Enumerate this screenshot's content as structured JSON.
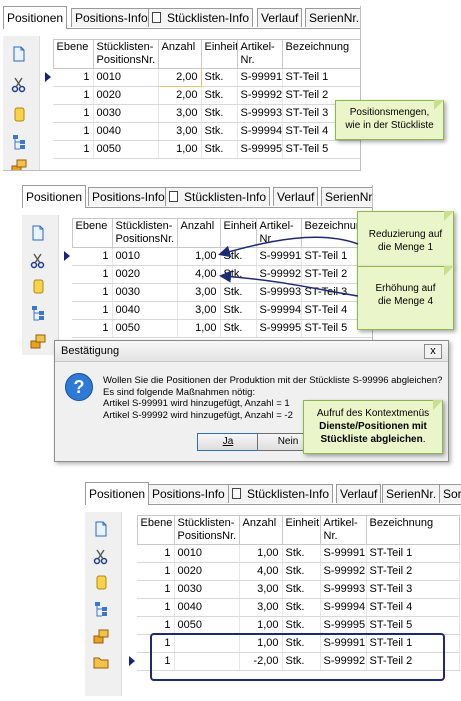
{
  "tabs": [
    "Positionen",
    "Positions-Info",
    "Stücklisten-Info",
    "Verlauf",
    "SerienNr.",
    "Sor"
  ],
  "columns": {
    "ebene": "Ebene",
    "pos": "Stücklisten-\nPositionsNr.",
    "anzahl": "Anzahl",
    "einheit": "Einheit",
    "artikel": "Artikel-\nNr.",
    "bezeichnung": "Bezeichnung"
  },
  "grid1": [
    {
      "ebene": "1",
      "pos": "0010",
      "anzahl": "2,00",
      "einheit": "Stk.",
      "artikel": "S-99991",
      "bez": "ST-Teil 1"
    },
    {
      "ebene": "1",
      "pos": "0020",
      "anzahl": "2,00",
      "einheit": "Stk.",
      "artikel": "S-99992",
      "bez": "ST-Teil 2"
    },
    {
      "ebene": "1",
      "pos": "0030",
      "anzahl": "3,00",
      "einheit": "Stk.",
      "artikel": "S-99993",
      "bez": "ST-Teil 3"
    },
    {
      "ebene": "1",
      "pos": "0040",
      "anzahl": "3,00",
      "einheit": "Stk.",
      "artikel": "S-99994",
      "bez": "ST-Teil 4"
    },
    {
      "ebene": "1",
      "pos": "0050",
      "anzahl": "1,00",
      "einheit": "Stk.",
      "artikel": "S-99995",
      "bez": "ST-Teil 5"
    }
  ],
  "grid2": [
    {
      "ebene": "1",
      "pos": "0010",
      "anzahl": "1,00",
      "einheit": "Stk.",
      "artikel": "S-99991",
      "bez": "ST-Teil 1"
    },
    {
      "ebene": "1",
      "pos": "0020",
      "anzahl": "4,00",
      "einheit": "Stk.",
      "artikel": "S-99992",
      "bez": "ST-Teil 2"
    },
    {
      "ebene": "1",
      "pos": "0030",
      "anzahl": "3,00",
      "einheit": "Stk.",
      "artikel": "S-99993",
      "bez": "ST-Teil 3"
    },
    {
      "ebene": "1",
      "pos": "0040",
      "anzahl": "3,00",
      "einheit": "Stk.",
      "artikel": "S-99994",
      "bez": "ST-Teil 4"
    },
    {
      "ebene": "1",
      "pos": "0050",
      "anzahl": "1,00",
      "einheit": "Stk.",
      "artikel": "S-99995",
      "bez": "ST-Teil 5"
    }
  ],
  "grid3": [
    {
      "ebene": "1",
      "pos": "0010",
      "anzahl": "1,00",
      "einheit": "Stk.",
      "artikel": "S-99991",
      "bez": "ST-Teil 1"
    },
    {
      "ebene": "1",
      "pos": "0020",
      "anzahl": "4,00",
      "einheit": "Stk.",
      "artikel": "S-99992",
      "bez": "ST-Teil 2"
    },
    {
      "ebene": "1",
      "pos": "0030",
      "anzahl": "3,00",
      "einheit": "Stk.",
      "artikel": "S-99993",
      "bez": "ST-Teil 3"
    },
    {
      "ebene": "1",
      "pos": "0040",
      "anzahl": "3,00",
      "einheit": "Stk.",
      "artikel": "S-99994",
      "bez": "ST-Teil 4"
    },
    {
      "ebene": "1",
      "pos": "0050",
      "anzahl": "1,00",
      "einheit": "Stk.",
      "artikel": "S-99995",
      "bez": "ST-Teil 5"
    },
    {
      "ebene": "1",
      "pos": "",
      "anzahl": "1,00",
      "einheit": "Stk.",
      "artikel": "S-99991",
      "bez": "ST-Teil 1"
    },
    {
      "ebene": "1",
      "pos": "",
      "anzahl": "-2,00",
      "einheit": "Stk.",
      "artikel": "S-99992",
      "bez": "ST-Teil 2"
    }
  ],
  "notes": {
    "mengen": "Positionsmengen,\nwie in der Stückliste",
    "reduzierung": "Reduzierung auf\ndie Menge 1",
    "erhoehung": "Erhöhung auf\ndie Menge 4",
    "kontext_pre": "Aufruf des Kontextmenüs",
    "kontext_bold": "Dienste/Positionen mit Stückliste abgleichen",
    "kontext_post": "."
  },
  "dialog": {
    "title": "Bestätigung",
    "message": "Wollen Sie die Positionen der Produktion mit der Stückliste S-99996 abgleichen?\nEs sind folgende Maßnahmen nötig:\nArtikel S-99991 wird hinzugefügt, Anzahl = 1\nArtikel S-99992 wird hinzugefügt, Anzahl = -2",
    "yes": "Ja",
    "no": "Nein",
    "close": "x",
    "icon": "?"
  }
}
